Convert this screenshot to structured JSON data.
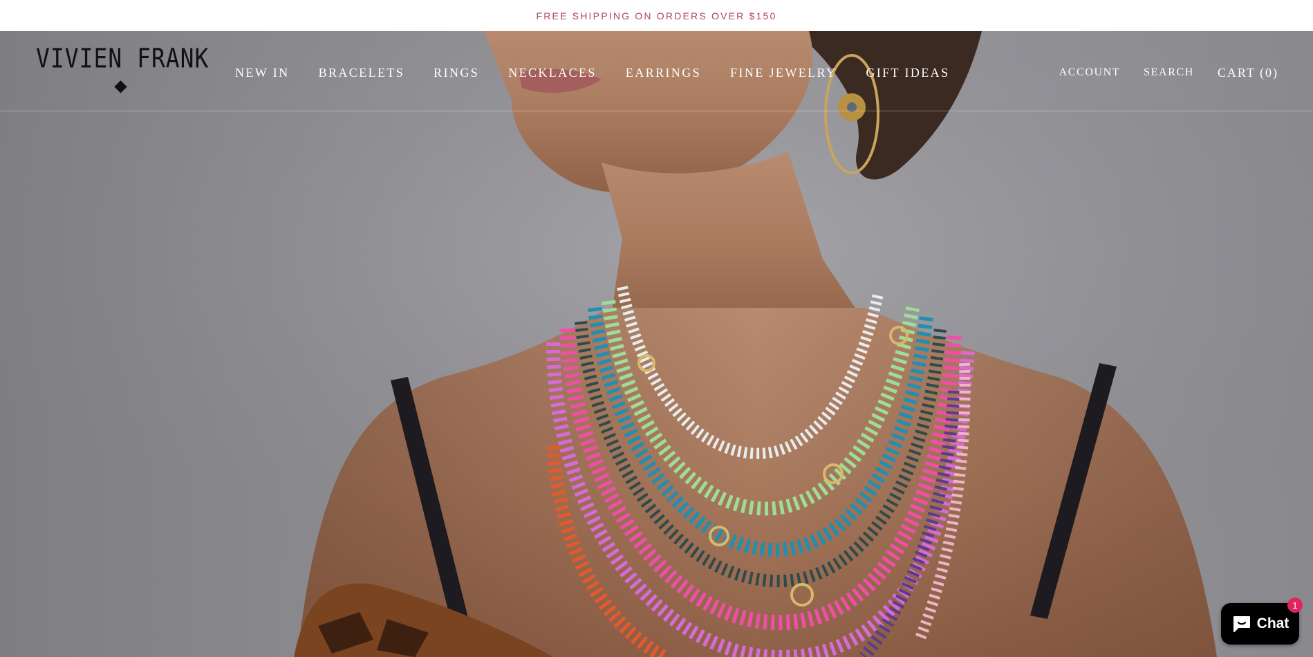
{
  "announcement": {
    "text": "FREE SHIPPING ON ORDERS OVER $150"
  },
  "header": {
    "logo_text": "VIVIEN FRANK",
    "nav": [
      {
        "label": "NEW IN"
      },
      {
        "label": "BRACELETS"
      },
      {
        "label": "RINGS"
      },
      {
        "label": "NECKLACES"
      },
      {
        "label": "EARRINGS"
      },
      {
        "label": "FINE JEWELRY"
      },
      {
        "label": "GIFT IDEAS"
      }
    ],
    "utility": {
      "account": "ACCOUNT",
      "search": "SEARCH",
      "cart": "CART (0)"
    }
  },
  "chat": {
    "label": "Chat",
    "badge": "1"
  },
  "colors": {
    "announcement_text": "#b3426e",
    "nav_text": "#ffffff",
    "logo": "#111111",
    "chat_bg": "#000000",
    "badge": "#e0245e"
  },
  "icons": [
    "diamond-icon",
    "chat-bubble-icon"
  ]
}
